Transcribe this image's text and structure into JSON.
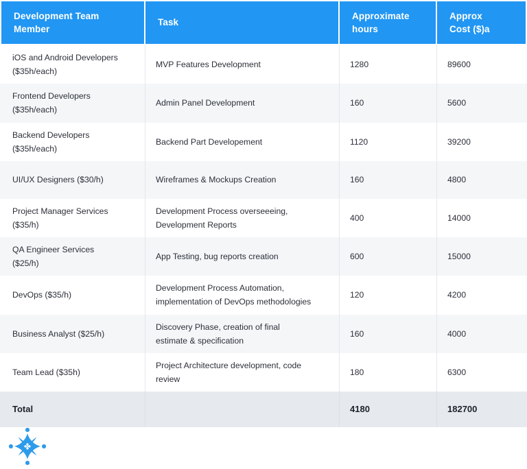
{
  "table": {
    "columns": [
      {
        "id": "member",
        "lines": [
          "Development Team",
          "Member"
        ]
      },
      {
        "id": "task",
        "lines": [
          "Task"
        ]
      },
      {
        "id": "hours",
        "lines": [
          "Approximate",
          "hours"
        ]
      },
      {
        "id": "cost",
        "lines": [
          "Approx",
          "Cost ($)a"
        ]
      }
    ],
    "rows": [
      {
        "member": [
          "iOS and Android Developers",
          "($35h/each)"
        ],
        "task": [
          "MVP Features Development"
        ],
        "hours": "1280",
        "cost": "89600"
      },
      {
        "member": [
          "Frontend Developers",
          "($35h/each)"
        ],
        "task": [
          "Admin Panel Development"
        ],
        "hours": "160",
        "cost": "5600"
      },
      {
        "member": [
          "Backend Developers",
          "($35h/each)"
        ],
        "task": [
          "Backend Part Developement"
        ],
        "hours": "1120",
        "cost": "39200"
      },
      {
        "member": [
          "UI/UX Designers ($30/h)"
        ],
        "task": [
          "Wireframes & Mockups Creation"
        ],
        "hours": "160",
        "cost": "4800"
      },
      {
        "member": [
          "Project Manager Services",
          "($35/h)"
        ],
        "task": [
          "Development Process overseeeing,",
          "Development Reports"
        ],
        "hours": "400",
        "cost": "14000"
      },
      {
        "member": [
          "QA Engineer Services",
          "($25/h)"
        ],
        "task": [
          "App Testing, bug reports creation"
        ],
        "hours": "600",
        "cost": "15000"
      },
      {
        "member": [
          "DevOps ($35/h)"
        ],
        "task": [
          "Development Process Automation,",
          "implementation of DevOps methodologies"
        ],
        "hours": "120",
        "cost": "4200"
      },
      {
        "member": [
          "Business Analyst ($25/h)"
        ],
        "task": [
          "Discovery Phase, creation of final",
          "estimate & specification"
        ],
        "hours": "160",
        "cost": "4000"
      },
      {
        "member": [
          "Team Lead ($35h)"
        ],
        "task": [
          "Project Architecture development, code",
          "review"
        ],
        "hours": "180",
        "cost": "6300"
      }
    ],
    "total": {
      "member": [
        "Total"
      ],
      "task": [
        ""
      ],
      "hours": "4180",
      "cost": "182700"
    }
  },
  "logo": {
    "name": "star-atom-logo",
    "color": "#2e9bea"
  },
  "colors": {
    "header_bg": "#2196f3",
    "header_text": "#ffffff",
    "row_bg": "#ffffff",
    "row_alt_bg": "#f4f6f8",
    "total_bg": "#e6eaef",
    "body_text": "#2b2f38",
    "divider": "#e3e7ec"
  }
}
